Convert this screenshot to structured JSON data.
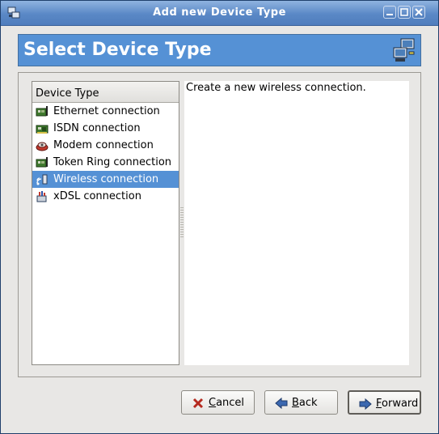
{
  "window": {
    "title": "Add new Device Type"
  },
  "header": {
    "title": "Select Device Type"
  },
  "device_list": {
    "column_header": "Device Type",
    "items": [
      {
        "label": "Ethernet connection",
        "icon": "ethernet-card-icon",
        "selected": false
      },
      {
        "label": "ISDN connection",
        "icon": "isdn-card-icon",
        "selected": false
      },
      {
        "label": "Modem connection",
        "icon": "modem-icon",
        "selected": false
      },
      {
        "label": "Token Ring connection",
        "icon": "token-ring-card-icon",
        "selected": false
      },
      {
        "label": "Wireless connection",
        "icon": "wireless-icon",
        "selected": true
      },
      {
        "label": "xDSL connection",
        "icon": "xdsl-icon",
        "selected": false
      }
    ]
  },
  "description": "Create a new wireless connection.",
  "buttons": {
    "cancel": {
      "first": "C",
      "rest": "ancel"
    },
    "back": {
      "first": "B",
      "rest": "ack"
    },
    "forward": {
      "first": "F",
      "rest": "orward"
    }
  },
  "colors": {
    "titlebar": "#5a88c6",
    "header": "#5591d5",
    "selection": "#5591d5"
  }
}
